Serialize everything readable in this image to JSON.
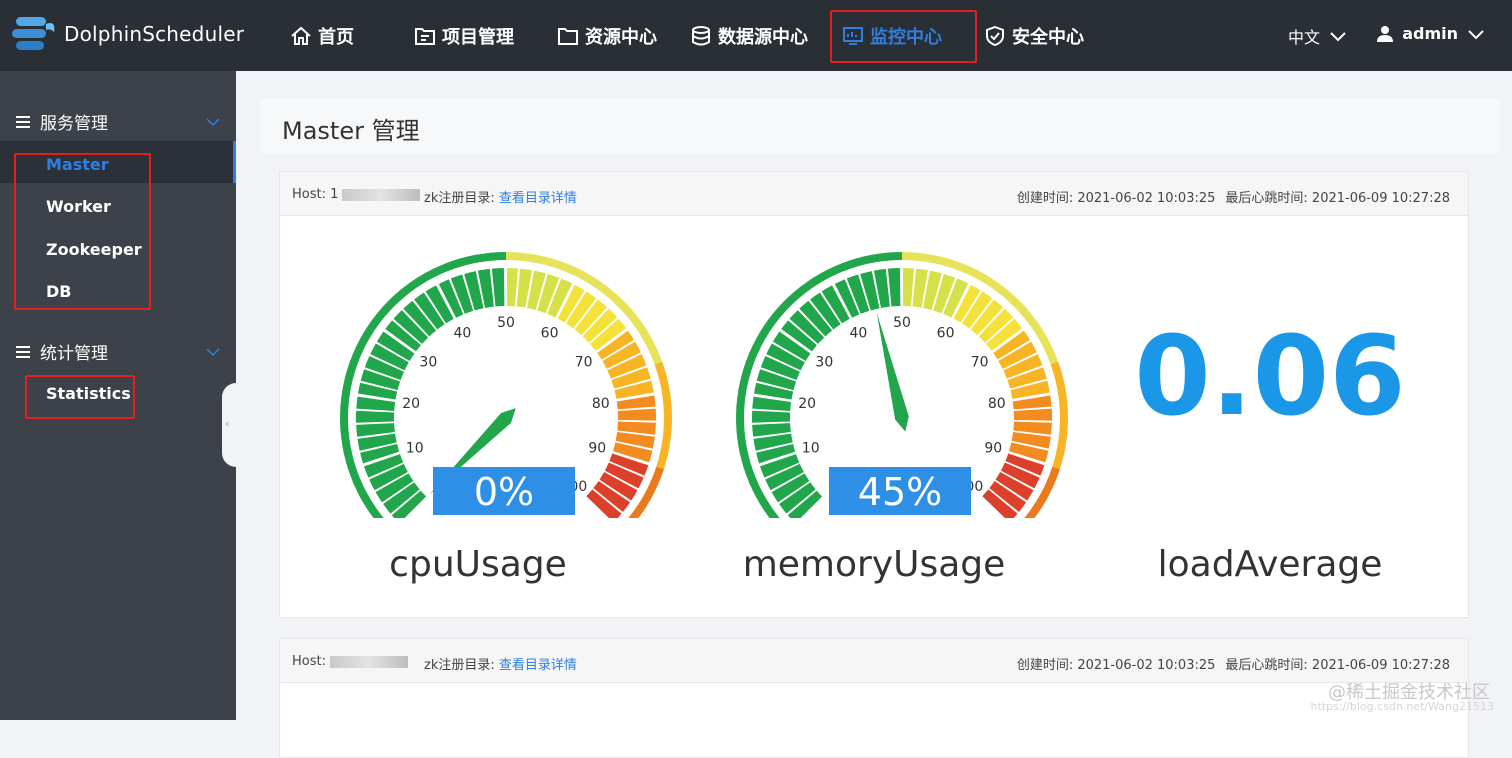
{
  "app": {
    "name": "DolphinScheduler"
  },
  "nav": [
    {
      "label": "首页",
      "icon": "home-icon"
    },
    {
      "label": "项目管理",
      "icon": "project-icon"
    },
    {
      "label": "资源中心",
      "icon": "folder-icon"
    },
    {
      "label": "数据源中心",
      "icon": "database-icon"
    },
    {
      "label": "监控中心",
      "icon": "monitor-icon",
      "active": true
    },
    {
      "label": "安全中心",
      "icon": "shield-icon"
    }
  ],
  "header": {
    "language": "中文",
    "user": "admin"
  },
  "sidebar": {
    "groups": [
      {
        "title": "服务管理",
        "items": [
          "Master",
          "Worker",
          "Zookeeper",
          "DB"
        ]
      },
      {
        "title": "统计管理",
        "items": [
          "Statistics"
        ]
      }
    ],
    "active_item": "Master"
  },
  "page": {
    "title": "Master 管理"
  },
  "cards": [
    {
      "host_label": "Host: 1",
      "zk_label": "zk注册目录:",
      "zk_link": "查看目录详情",
      "create_time": "创建时间: 2021-06-02 10:03:25",
      "heartbeat_time": "最后心跳时间: 2021-06-09 10:27:28",
      "cpu": {
        "value": 0,
        "display": "0%",
        "label": "cpuUsage"
      },
      "memory": {
        "value": 45,
        "display": "45%",
        "label": "memoryUsage"
      },
      "load": {
        "display": "0.06",
        "label": "loadAverage"
      }
    },
    {
      "host_label": "Host:",
      "zk_label": "zk注册目录:",
      "zk_link": "查看目录详情",
      "create_time": "创建时间: 2021-06-02 10:03:25",
      "heartbeat_time": "最后心跳时间: 2021-06-09 10:27:28"
    }
  ],
  "gauge_ticks": [
    "0",
    "10",
    "20",
    "30",
    "40",
    "50",
    "60",
    "70",
    "80",
    "90",
    "100"
  ],
  "colors": {
    "accent": "#2e7fe1",
    "topbar": "#2a2e35",
    "sidebar": "#3c414a",
    "load": "#1a97e6",
    "highlight": "#e3201f"
  },
  "watermark": {
    "text": "@稀土掘金技术社区",
    "url_text": "https://blog.csdn.net/Wang21513"
  }
}
